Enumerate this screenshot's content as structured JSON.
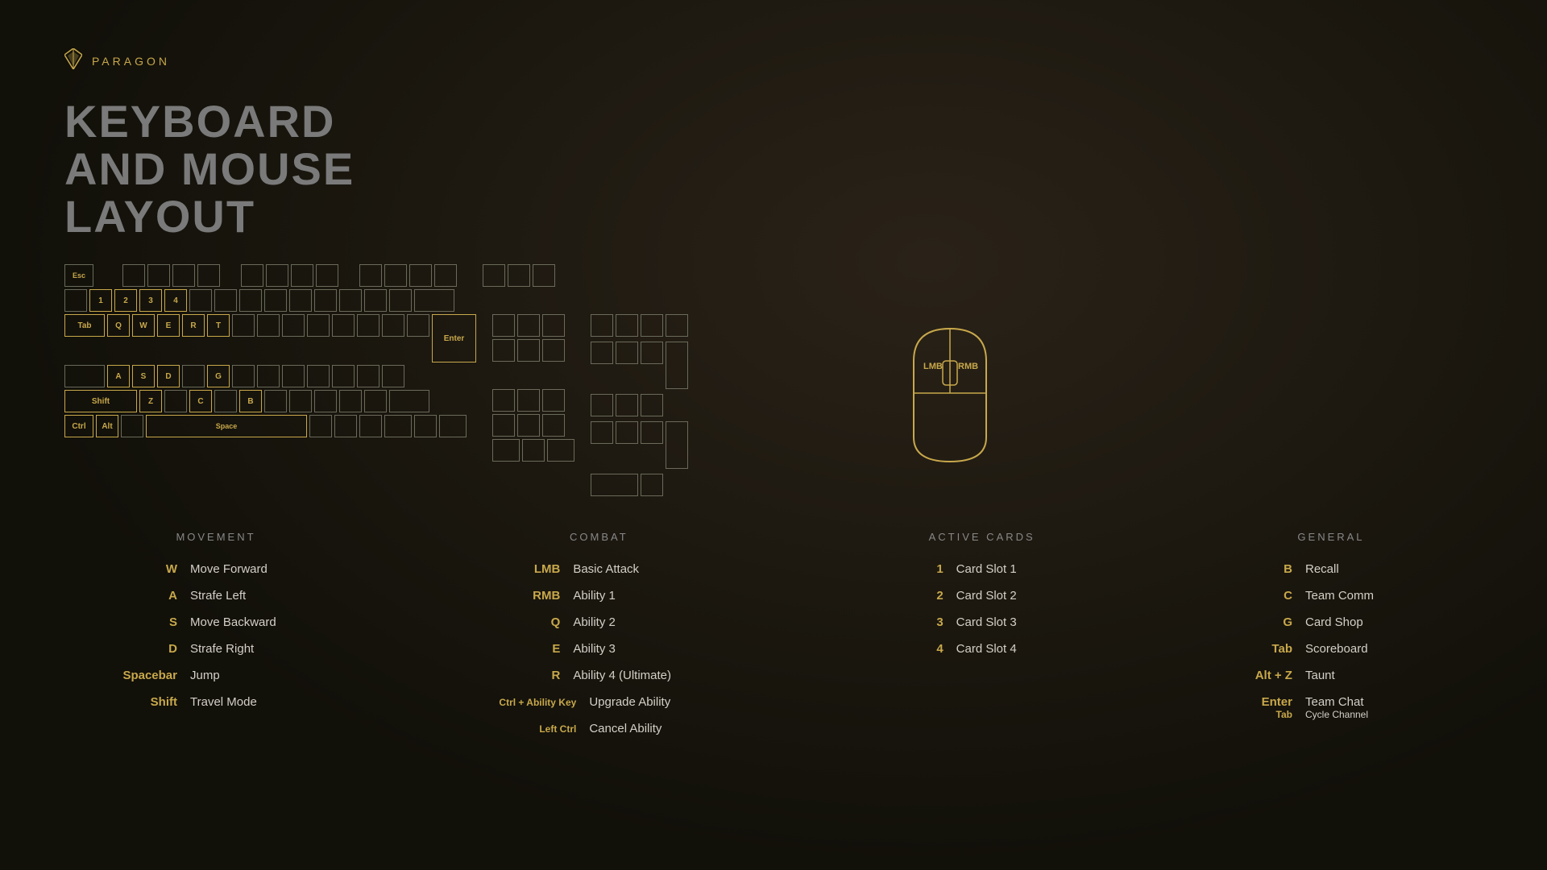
{
  "logo": {
    "text": "PARAGON"
  },
  "title": {
    "line1": "KEYBOARD",
    "line2": "AND MOUSE",
    "line3": "LAYOUT"
  },
  "keyboard": {
    "highlighted_keys": [
      "Q",
      "W",
      "E",
      "R",
      "T",
      "A",
      "S",
      "D",
      "G",
      "Z",
      "C",
      "B",
      "1",
      "2",
      "3",
      "4",
      "Tab",
      "Shift",
      "Ctrl",
      "Alt",
      "Space",
      "Enter",
      "Esc"
    ]
  },
  "movement": {
    "title": "MOVEMENT",
    "bindings": [
      {
        "key": "W",
        "action": "Move Forward"
      },
      {
        "key": "A",
        "action": "Strafe Left"
      },
      {
        "key": "S",
        "action": "Move Backward"
      },
      {
        "key": "D",
        "action": "Strafe Right"
      },
      {
        "key": "Spacebar",
        "action": "Jump"
      },
      {
        "key": "Shift",
        "action": "Travel Mode"
      }
    ]
  },
  "combat": {
    "title": "COMBAT",
    "bindings": [
      {
        "key": "LMB",
        "action": "Basic Attack"
      },
      {
        "key": "RMB",
        "action": "Ability 1"
      },
      {
        "key": "Q",
        "action": "Ability 2"
      },
      {
        "key": "E",
        "action": "Ability 3"
      },
      {
        "key": "R",
        "action": "Ability 4 (Ultimate)"
      },
      {
        "key": "Ctrl + Ability Key",
        "action": "Upgrade Ability"
      },
      {
        "key": "Left Ctrl",
        "action": "Cancel Ability"
      }
    ]
  },
  "active_cards": {
    "title": "ACTIVE CARDS",
    "bindings": [
      {
        "key": "1",
        "action": "Card Slot 1"
      },
      {
        "key": "2",
        "action": "Card Slot 2"
      },
      {
        "key": "3",
        "action": "Card Slot 3"
      },
      {
        "key": "4",
        "action": "Card Slot 4"
      }
    ]
  },
  "general": {
    "title": "GENERAL",
    "bindings": [
      {
        "key": "B",
        "action": "Recall"
      },
      {
        "key": "C",
        "action": "Team Comm"
      },
      {
        "key": "G",
        "action": "Card Shop"
      },
      {
        "key": "Tab",
        "action": "Scoreboard"
      },
      {
        "key": "Alt + Z",
        "action": "Taunt"
      },
      {
        "key": "Enter",
        "action": "Team Chat"
      },
      {
        "key": "Tab",
        "action": "Cycle Channel"
      }
    ]
  }
}
